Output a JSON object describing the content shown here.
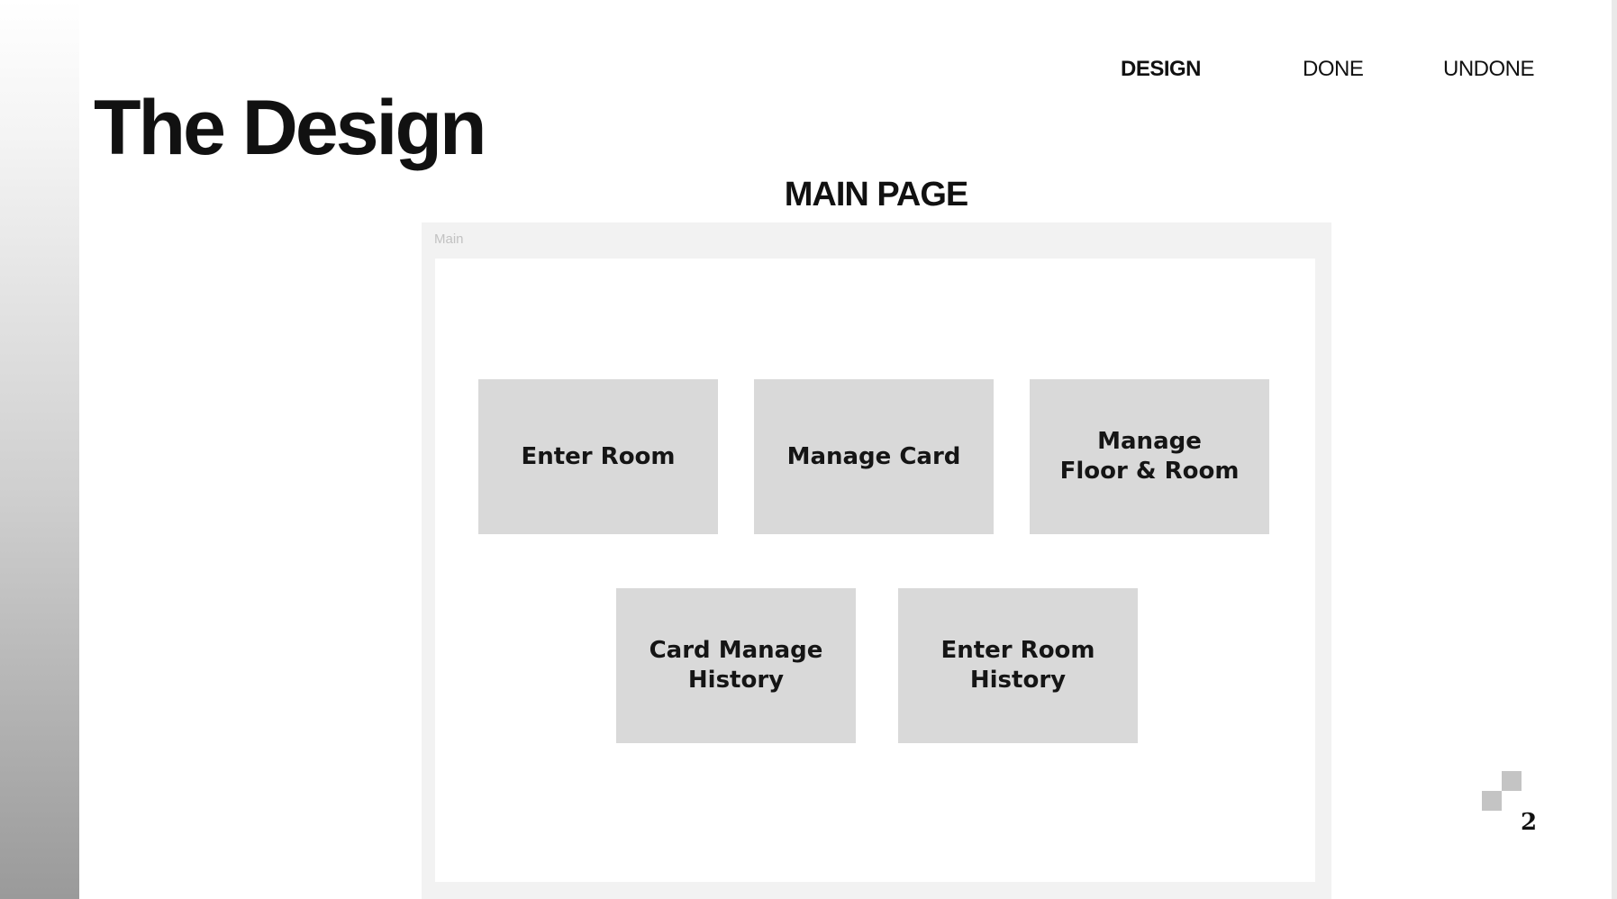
{
  "nav": {
    "items": [
      {
        "label": "DESIGN",
        "active": true
      },
      {
        "label": "DONE",
        "active": false
      },
      {
        "label": "UNDONE",
        "active": false
      }
    ]
  },
  "header": {
    "title": "The Design"
  },
  "section": {
    "title": "MAIN PAGE"
  },
  "mockup": {
    "frame_label": "Main",
    "cards": [
      {
        "label": "Enter Room"
      },
      {
        "label": "Manage Card"
      },
      {
        "label": "Manage\nFloor & Room"
      },
      {
        "label": "Card Manage\nHistory"
      },
      {
        "label": "Enter Room\nHistory"
      }
    ]
  },
  "footer": {
    "page_number": "2"
  },
  "colors": {
    "card_bg": "#d9d9d9",
    "frame_bg": "#f2f2f2",
    "accent_text": "#111111"
  }
}
